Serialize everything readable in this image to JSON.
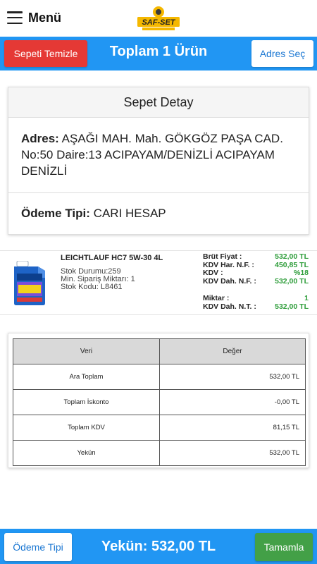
{
  "header": {
    "menu_label": "Menü",
    "logo_text": "SAF-SET"
  },
  "actionbar": {
    "clear_label": "Sepeti Temizle",
    "title": "Toplam 1 Ürün",
    "address_label": "Adres Seç"
  },
  "detail": {
    "heading": "Sepet Detay",
    "address_key": "Adres:",
    "address_value": "AŞAĞI MAH. Mah. GÖKGÖZ PAŞA CAD. No:50 Daire:13 ACIPAYAM/DENİZLİ ACIPAYAM DENİZLİ",
    "payment_key": "Ödeme Tipi:",
    "payment_value": "CARI HESAP"
  },
  "product": {
    "name": "LEICHTLAUF HC7 5W-30 4L",
    "stock_status": "Stok Durumu:259",
    "min_order": "Min. Sipariş Miktarı: 1",
    "stock_code": "Stok Kodu: L8461",
    "prices": [
      {
        "key": "Brüt Fiyat :",
        "value": "532,00 TL"
      },
      {
        "key": "KDV Har. N.F. :",
        "value": "450,85 TL"
      },
      {
        "key": "KDV :",
        "value": "%18"
      },
      {
        "key": "KDV Dah. N.F. :",
        "value": "532,00 TL"
      }
    ],
    "qty": [
      {
        "key": "Miktar :",
        "value": "1"
      },
      {
        "key": "KDV Dah. N.T. :",
        "value": "532,00 TL"
      }
    ]
  },
  "summary": {
    "headers": [
      "Veri",
      "Değer"
    ],
    "rows": [
      {
        "label": "Ara Toplam",
        "value": "532,00 TL"
      },
      {
        "label": "Toplam İskonto",
        "value": "-0,00 TL"
      },
      {
        "label": "Toplam KDV",
        "value": "81,15 TL"
      },
      {
        "label": "Yekün",
        "value": "532,00 TL"
      }
    ]
  },
  "footer": {
    "payment_label": "Ödeme Tipi",
    "total": "Yekün: 532,00 TL",
    "complete_label": "Tamamla"
  },
  "colors": {
    "primary": "#2196f3",
    "danger": "#e53935",
    "success": "#43a047",
    "price_green": "#2e9d3a"
  }
}
